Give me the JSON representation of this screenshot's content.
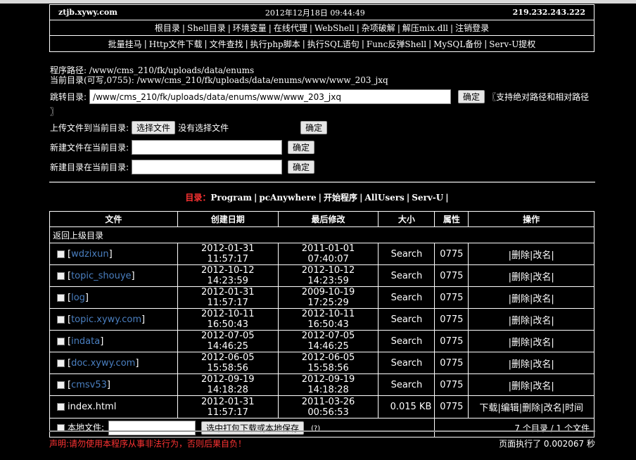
{
  "header": {
    "domain": "ztjb.xywy.com",
    "datetime": "2012年12月18日 09:44:49",
    "ip": "219.232.243.222",
    "nav1": [
      "根目录",
      "Shell目录",
      "环境变量",
      "在线代理",
      "WebShell",
      "杂项破解",
      "解压mix.dll",
      "注销登录"
    ],
    "nav2": [
      "批量挂马",
      "Http文件下载",
      "文件查找",
      "执行php脚本",
      "执行SQL语句",
      "Func反弹Shell",
      "MySQL备份",
      "Serv-U提权"
    ]
  },
  "paths": {
    "program_path": "程序路径: /www/cms_210/fk/uploads/data/enums",
    "current_dir": "当前目录(可写,0755): /www/cms_210/fk/uploads/data/enums/www/www_203_jxq"
  },
  "jump": {
    "label": "跳转目录:",
    "value": "/www/cms_210/fk/uploads/data/enums/www/www_203_jxq",
    "button": "确定",
    "hint": "〖支持绝对路径和相对路径",
    "hint_end": "〗"
  },
  "upload": {
    "label": "上传文件到当前目录:",
    "choose_button": "选择文件",
    "no_file": "没有选择文件",
    "button": "确定"
  },
  "new_file": {
    "label": "新建文件在当前目录:",
    "value": "",
    "button": "确定"
  },
  "new_dir": {
    "label": "新建目录在当前目录:",
    "value": "",
    "button": "确定"
  },
  "dirs": {
    "label": "目录：",
    "items": [
      "Program",
      "pcAnywhere",
      "开始程序",
      "AllUsers",
      "Serv-U"
    ]
  },
  "table": {
    "headers": [
      "文件",
      "创建日期",
      "最后修改",
      "大小",
      "属性",
      "操作"
    ],
    "parent": "返回上级目录",
    "folders": [
      {
        "name": "wdzixun",
        "created": "2012-01-31 11:57:17",
        "modified": "2011-01-01 07:40:07",
        "size": "Search",
        "attr": "0775"
      },
      {
        "name": "topic_shouye",
        "created": "2012-10-12 14:23:59",
        "modified": "2012-10-12 14:23:59",
        "size": "Search",
        "attr": "0775"
      },
      {
        "name": "log",
        "created": "2012-01-31 11:57:17",
        "modified": "2009-10-19 17:25:29",
        "size": "Search",
        "attr": "0775"
      },
      {
        "name": "topic.xywy.com",
        "created": "2012-10-11 16:50:43",
        "modified": "2012-10-11 16:50:43",
        "size": "Search",
        "attr": "0775"
      },
      {
        "name": "indata",
        "created": "2012-07-05 14:46:25",
        "modified": "2012-07-05 14:46:25",
        "size": "Search",
        "attr": "0775"
      },
      {
        "name": "doc.xywy.com",
        "created": "2012-06-05 15:58:56",
        "modified": "2012-06-05 15:58:56",
        "size": "Search",
        "attr": "0775"
      },
      {
        "name": "cmsv53",
        "created": "2012-09-19 14:18:28",
        "modified": "2012-09-19 14:18:28",
        "size": "Search",
        "attr": "0775"
      }
    ],
    "folder_ops": [
      "删除",
      "改名"
    ],
    "file": {
      "name": "index.html",
      "created": "2012-01-31 11:57:17",
      "modified": "2011-03-26 00:56:53",
      "size": "0.015 KB",
      "attr": "0775"
    },
    "file_ops": [
      "下载",
      "编辑",
      "删除",
      "改名",
      "时间"
    ],
    "local_label": "本地文件:",
    "pack_button": "选中打包下载或本地保存",
    "help": "(?)",
    "summary": "7 个目录 / 1 个文件"
  },
  "footer": {
    "warning": "声明:请勿使用本程序从事非法行为，否则后果自负！",
    "exec_time": "页面执行了 0.002067 秒"
  }
}
